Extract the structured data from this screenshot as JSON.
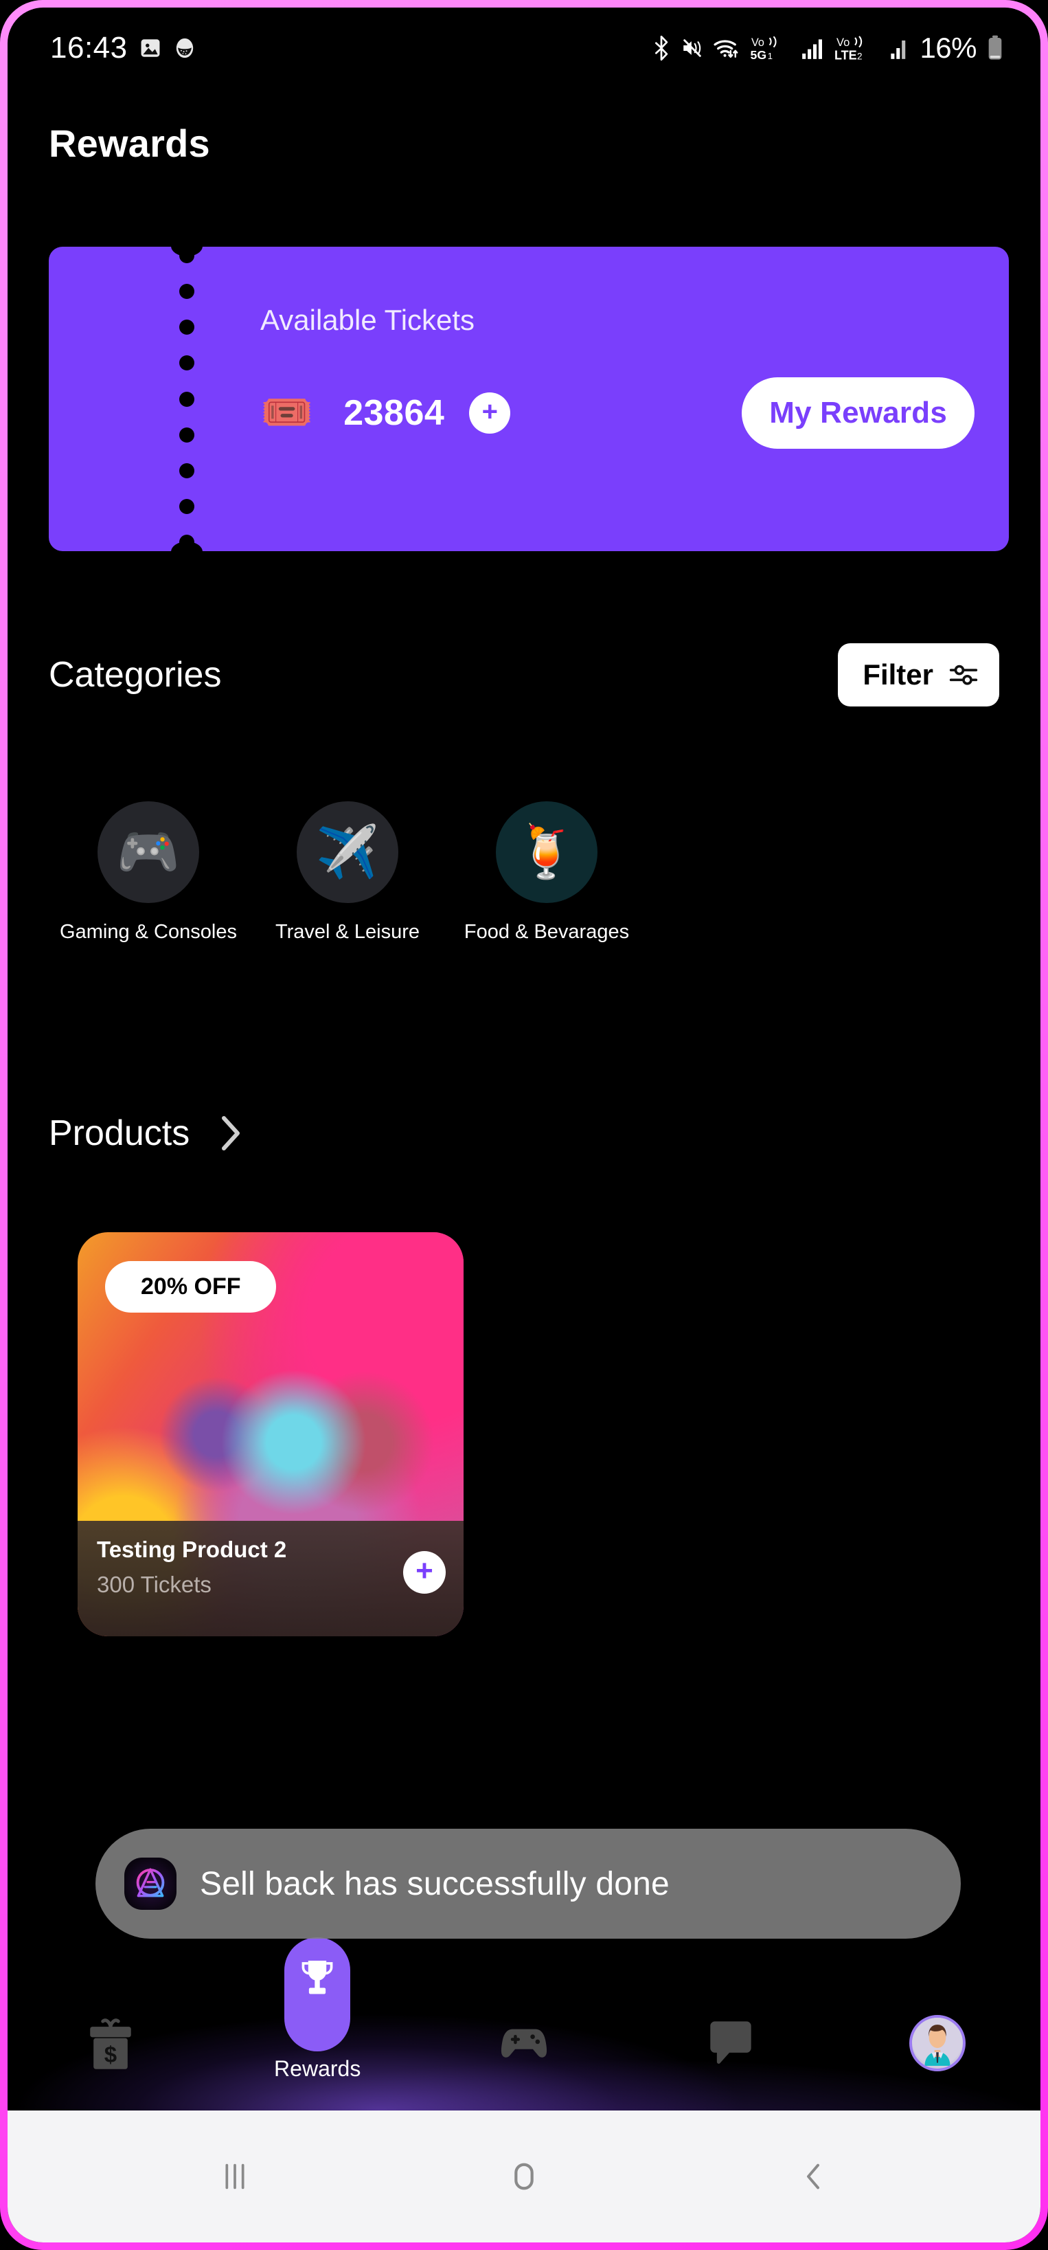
{
  "status_bar": {
    "time": "16:43",
    "left_icons": [
      "image-icon",
      "app-icon"
    ],
    "right_icons": [
      "bluetooth-icon",
      "mute-icon",
      "wifi-icon",
      "volte-5g1-icon",
      "signal-1-icon",
      "volte-lte2-icon",
      "signal-2-icon"
    ],
    "battery_percent": "16%",
    "network_1_label": "Vo))",
    "network_1_sub": "5G1",
    "network_2_label": "Vo))",
    "network_2_sub": "LTE2"
  },
  "page": {
    "title": "Rewards"
  },
  "ticket_card": {
    "label": "Available Tickets",
    "count": "23864",
    "ticket_emoji": "🎟️",
    "add_label": "+",
    "my_rewards_label": "My Rewards",
    "background_color": "#7a3ffc",
    "accent_color": "#ffffff"
  },
  "categories": {
    "title": "Categories",
    "filter_label": "Filter",
    "items": [
      {
        "label": "Gaming & Consoles",
        "emoji": "🎮",
        "icon": "gamepad-icon",
        "circle_color": "#25262b"
      },
      {
        "label": "Travel & Leisure",
        "emoji": "✈️",
        "icon": "airplane-icon",
        "circle_color": "#25262b"
      },
      {
        "label": "Food & Bevarages",
        "emoji": "🍹",
        "icon": "cocktail-icon",
        "circle_color": "#0d2b30"
      }
    ]
  },
  "products": {
    "title": "Products",
    "chevron": "chevron-right-icon",
    "items": [
      {
        "discount_badge": "20% OFF",
        "name": "Testing Product 2",
        "price": "300 Tickets",
        "add_label": "+",
        "image": "chameleon-photo"
      }
    ]
  },
  "toast": {
    "message": "Sell back has successfully done",
    "logo": "app-logo-icon"
  },
  "bottom_nav": {
    "items": [
      {
        "label": "",
        "icon": "gift-money-icon",
        "active": false
      },
      {
        "label": "Rewards",
        "icon": "trophy-icon",
        "active": true
      },
      {
        "label": "",
        "icon": "gamepad-icon",
        "active": false
      },
      {
        "label": "",
        "icon": "chat-bubble-icon",
        "active": false
      },
      {
        "label": "",
        "icon": "avatar-icon",
        "active": false
      }
    ],
    "active_color": "#8b5cf6"
  },
  "system_nav": {
    "buttons": [
      {
        "name": "recents-button",
        "icon": "recents-icon"
      },
      {
        "name": "home-button",
        "icon": "home-icon"
      },
      {
        "name": "back-button",
        "icon": "back-icon"
      }
    ]
  },
  "frame": {
    "border_color": "#ff6bf7"
  }
}
